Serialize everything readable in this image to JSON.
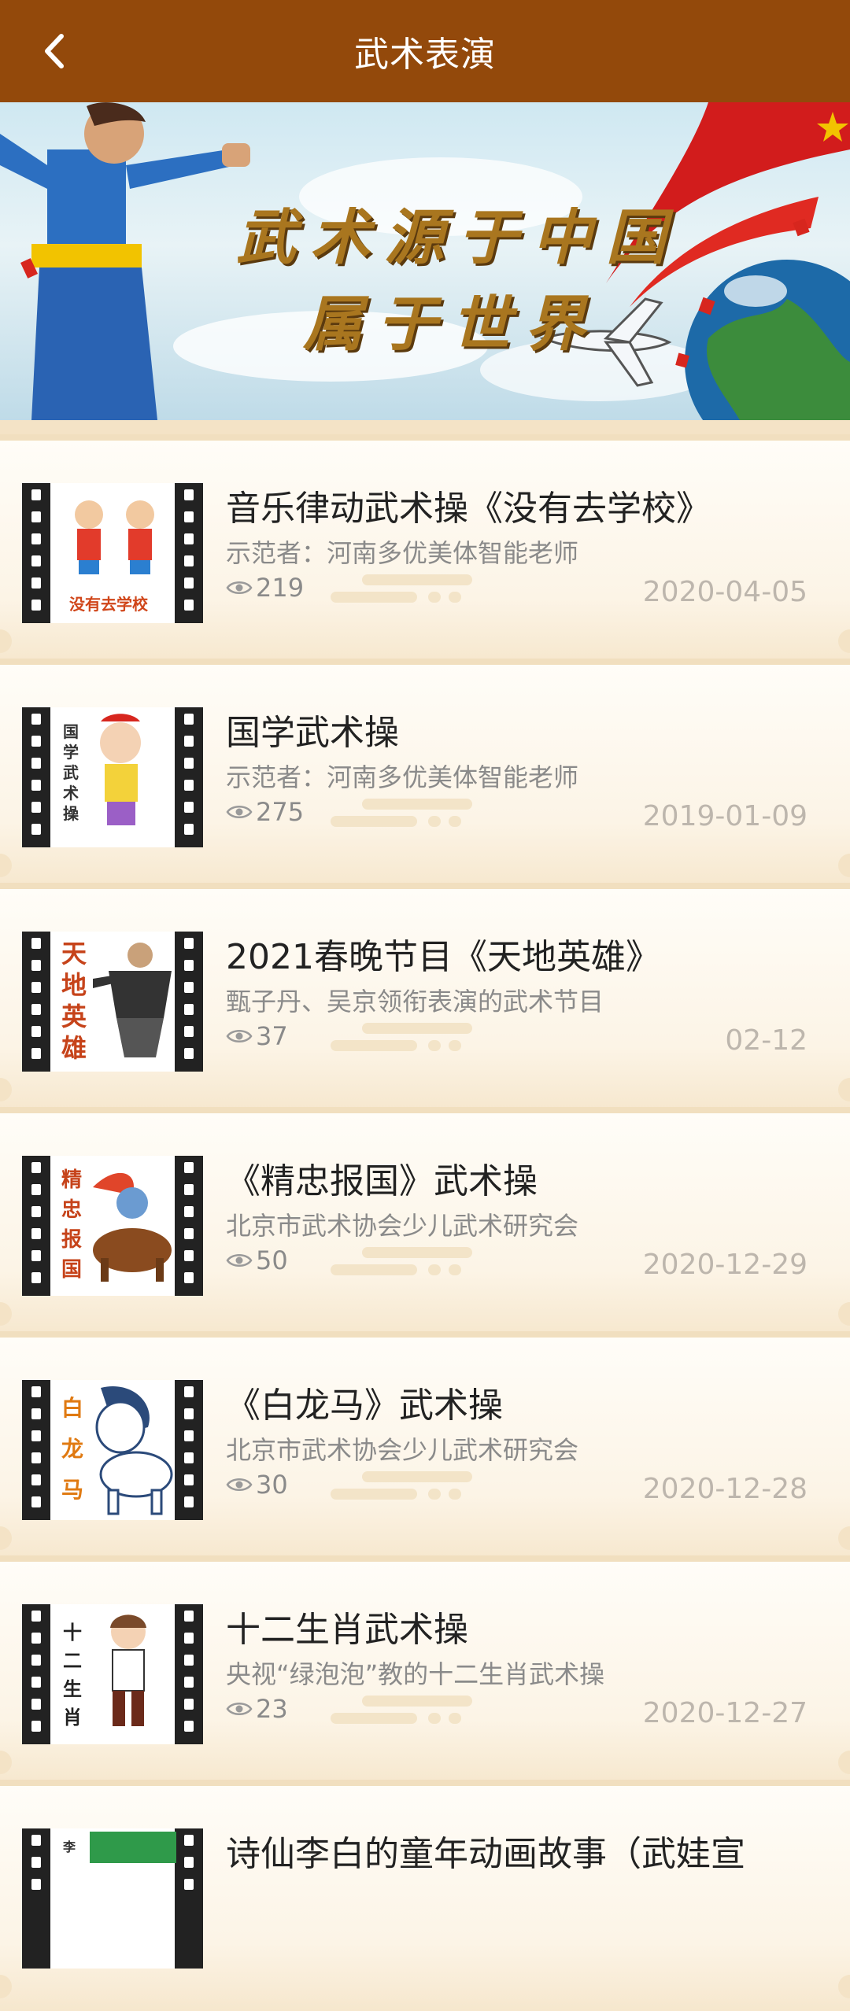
{
  "header": {
    "title": "武术表演",
    "back_icon": "chevron-left-icon"
  },
  "banner": {
    "line1": "武术源于中国",
    "line2": "属于世界"
  },
  "items": [
    {
      "title": "音乐律动武术操《没有去学校》",
      "subtitle": "示范者：河南多优美体智能老师",
      "views": "219",
      "date": "2020-04-05",
      "thumb_text": "没有去学校"
    },
    {
      "title": "国学武术操",
      "subtitle": "示范者：河南多优美体智能老师",
      "views": "275",
      "date": "2019-01-09",
      "thumb_text": "国学武术操"
    },
    {
      "title": "2021春晚节目《天地英雄》",
      "subtitle": "甄子丹、吴京领衔表演的武术节目",
      "views": "37",
      "date": "02-12",
      "thumb_text": "天地英雄"
    },
    {
      "title": "《精忠报国》武术操",
      "subtitle": "北京市武术协会少儿武术研究会",
      "views": "50",
      "date": "2020-12-29",
      "thumb_text": "精忠报国"
    },
    {
      "title": "《白龙马》武术操",
      "subtitle": "北京市武术协会少儿武术研究会",
      "views": "30",
      "date": "2020-12-28",
      "thumb_text": "白龙马"
    },
    {
      "title": "十二生肖武术操",
      "subtitle": "央视“绿泡泡”教的十二生肖武术操",
      "views": "23",
      "date": "2020-12-27",
      "thumb_text": "十二生肖"
    },
    {
      "title": "诗仙李白的童年动画故事（武娃宣",
      "subtitle": "",
      "views": "",
      "date": "",
      "thumb_text": "李"
    }
  ],
  "colors": {
    "header_bg": "#93490b",
    "page_bg": "#f4e3c6",
    "thumb_accent": "#d0461a"
  }
}
